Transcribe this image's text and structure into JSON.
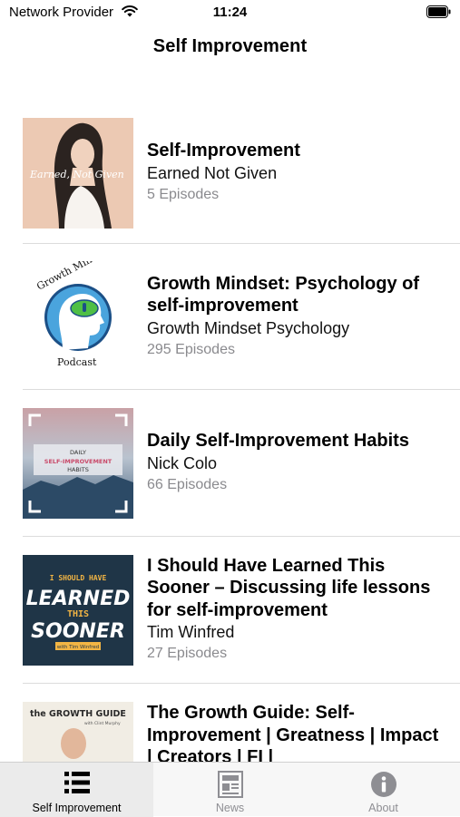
{
  "status_bar": {
    "carrier": "Network Provider",
    "time": "11:24"
  },
  "nav": {
    "title": "Self Improvement"
  },
  "podcasts": [
    {
      "title": "Self-Improvement",
      "author": "Earned Not Given",
      "episodes": "5 Episodes",
      "art_text": "Earned, Not Given"
    },
    {
      "title": "Growth Mindset: Psychology of self-improvement",
      "author": "Growth Mindset Psychology",
      "episodes": "295 Episodes",
      "art_top": "Growth Mindset",
      "art_bottom": "Podcast"
    },
    {
      "title": "Daily Self-Improvement Habits",
      "author": "Nick Colo",
      "episodes": "66 Episodes",
      "art_line1": "DAILY",
      "art_line2": "SELF-IMPROVEMENT",
      "art_line3": "HABITS"
    },
    {
      "title": "I Should Have Learned This Sooner – Discussing life lessons for self-improvement",
      "author": "Tim Winfred",
      "episodes": "27 Episodes",
      "art_line1": "I SHOULD HAVE",
      "art_line2": "LEARNED",
      "art_line3": "THIS",
      "art_line4": "SOONER",
      "art_line5": "with Tim Winfred"
    },
    {
      "title": "The Growth Guide: Self-Improvement | Greatness | Impact | Creators | FI |",
      "art_line1": "the GROWTH GUIDE",
      "art_line2": "with Clint Murphy"
    }
  ],
  "tabs": [
    {
      "label": "Self Improvement",
      "icon": "list-icon",
      "active": true
    },
    {
      "label": "News",
      "icon": "newspaper-icon",
      "active": false
    },
    {
      "label": "About",
      "icon": "info-icon",
      "active": false
    }
  ],
  "colors": {
    "accent": "#000000",
    "inactive": "#8e8e93",
    "separator": "#dcdcdc"
  }
}
